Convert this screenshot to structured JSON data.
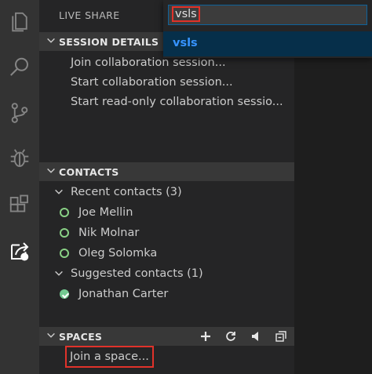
{
  "sidebar": {
    "title": "LIVE SHARE",
    "session_details": {
      "header": "SESSION DETAILS",
      "items": [
        "Join collaboration session...",
        "Start collaboration session...",
        "Start read-only collaboration sessio..."
      ]
    },
    "contacts": {
      "header": "CONTACTS",
      "recent": {
        "label": "Recent contacts (3)",
        "people": [
          "Joe Mellin",
          "Nik Molnar",
          "Oleg Solomka"
        ]
      },
      "suggested": {
        "label": "Suggested contacts (1)",
        "people": [
          "Jonathan Carter"
        ]
      }
    },
    "spaces": {
      "header": "SPACES",
      "join": "Join a space..."
    }
  },
  "quick_open": {
    "value": "vsls",
    "result": "vsls"
  },
  "colors": {
    "accent_link": "#3794ff",
    "status_online": "#89d185",
    "highlight_box": "#e0322a"
  },
  "icons": {
    "activity_bar": [
      "files-icon",
      "search-icon",
      "source-control-icon",
      "debug-icon",
      "extensions-icon",
      "live-share-icon"
    ],
    "spaces_toolbar": [
      "add-icon",
      "refresh-icon",
      "mute-icon",
      "collapse-all-icon"
    ]
  }
}
